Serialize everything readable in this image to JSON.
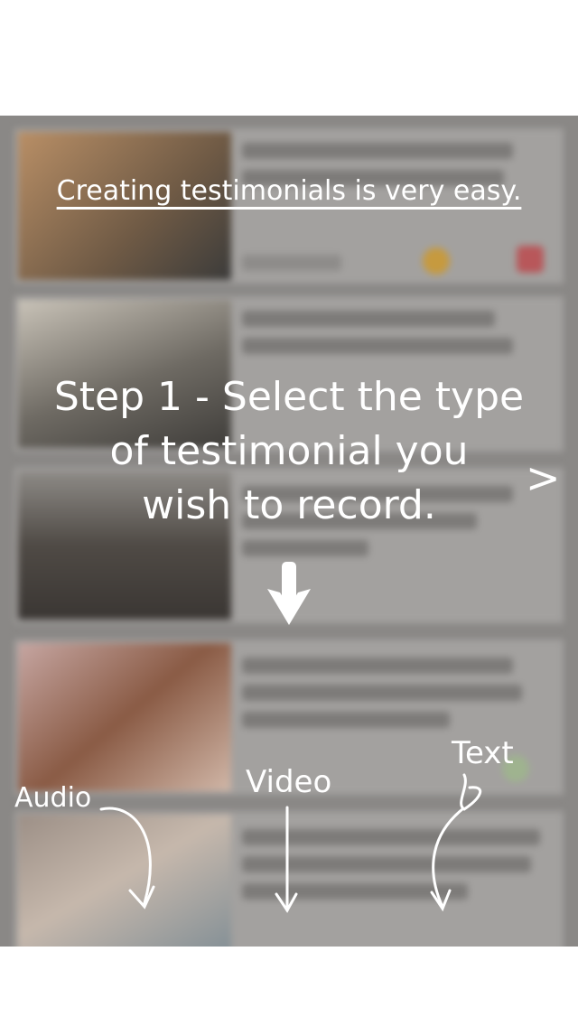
{
  "overlay": {
    "headline": "Creating testimonials is very easy.",
    "step": {
      "line1": "Step 1 - Select the type",
      "line2": "of testimonial you",
      "line3": "wish to record."
    },
    "next_glyph": ">",
    "options": {
      "audio": "Audio",
      "video": "Video",
      "text": "Text"
    }
  }
}
